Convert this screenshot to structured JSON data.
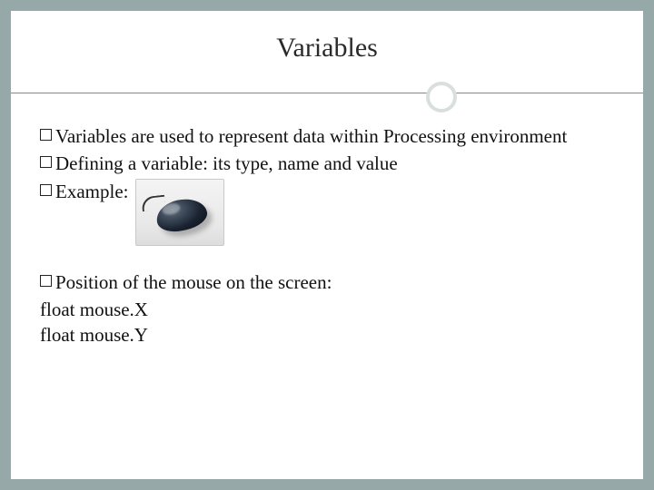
{
  "title": "Variables",
  "bullets": {
    "b1": "Variables are used to represent data within Processing environment",
    "b2": "Defining a variable: its type, name and value",
    "b3": "Example:",
    "b4": "Position of the mouse on the screen:"
  },
  "lines": {
    "l1": "float mouse.X",
    "l2": "float mouse.Y"
  },
  "image": {
    "alt": "computer-mouse-image"
  }
}
